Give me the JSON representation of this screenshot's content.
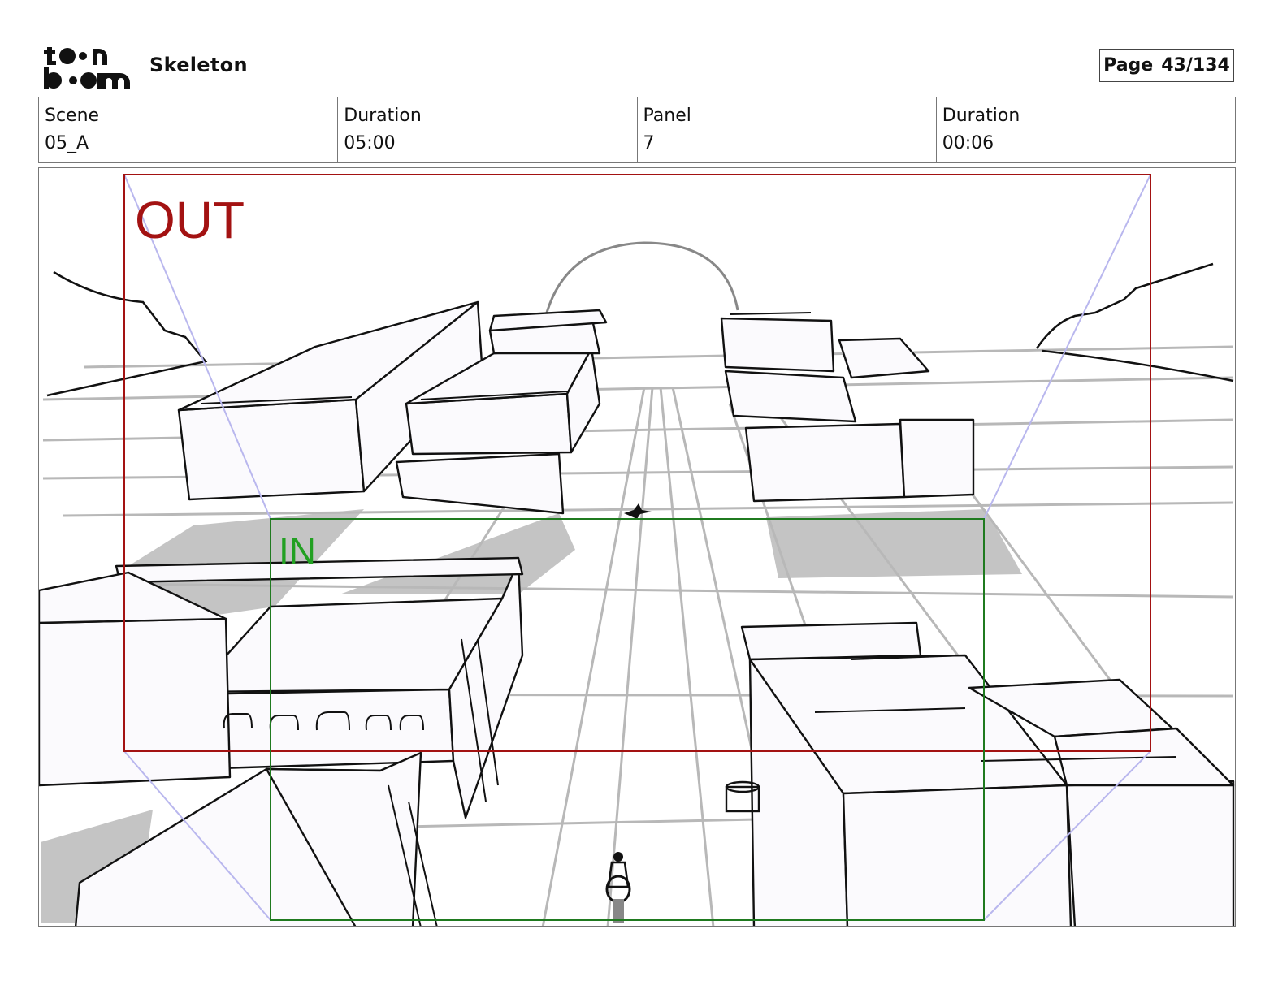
{
  "header": {
    "logo_text": "toon boom",
    "project": "Skeleton",
    "page_label": "Page",
    "page_value": "43/134"
  },
  "info": {
    "scene_label": "Scene",
    "scene_value": "05_A",
    "scene_duration_label": "Duration",
    "scene_duration_value": "05:00",
    "panel_label": "Panel",
    "panel_value": "7",
    "panel_duration_label": "Duration",
    "panel_duration_value": "00:06"
  },
  "panel_frames": {
    "out_label": "OUT",
    "in_label": "IN",
    "out_color": "#a31212",
    "in_color": "#1f7a1f",
    "guide_color": "#b9b7ee"
  }
}
